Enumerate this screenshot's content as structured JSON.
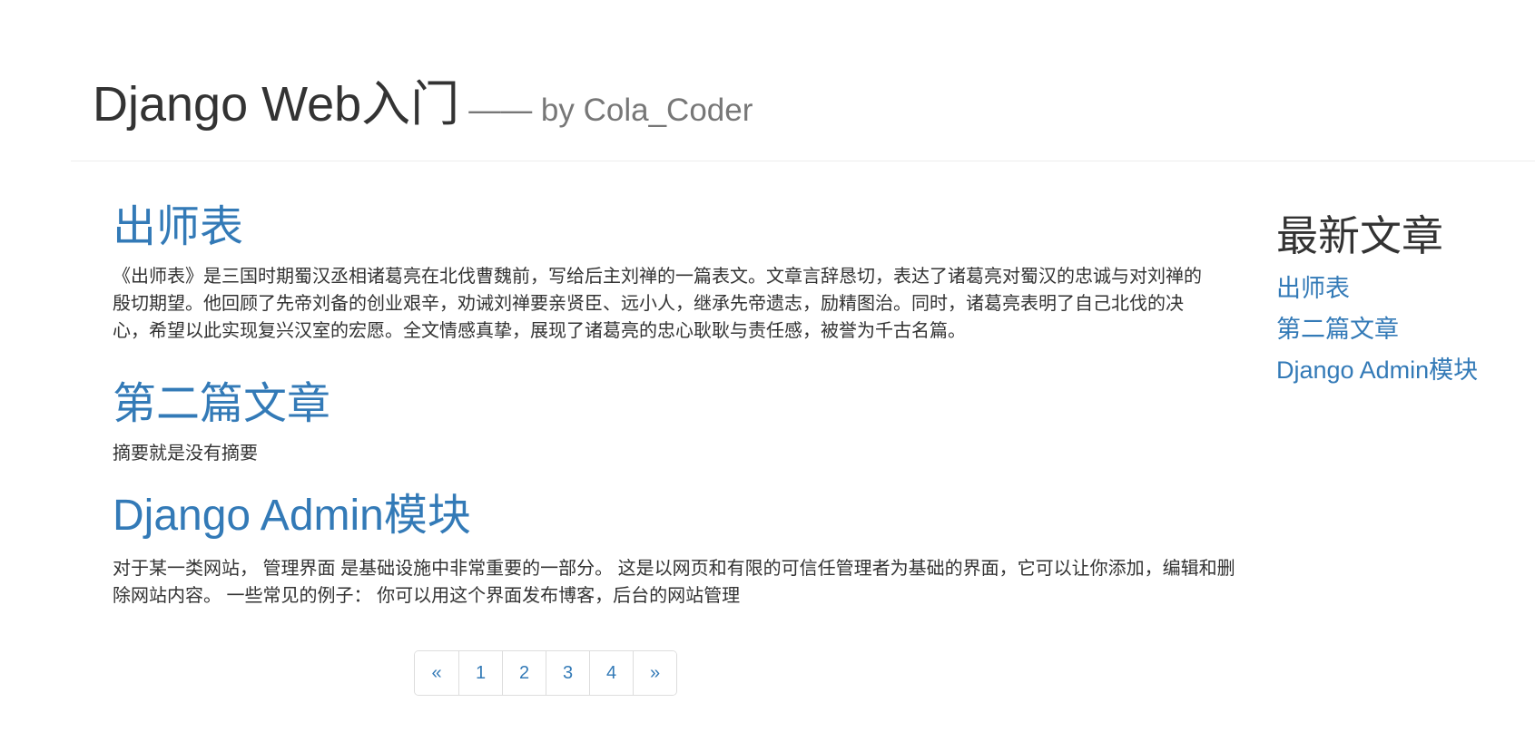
{
  "header": {
    "title": "Django Web入门",
    "subtitle": "—— by Cola_Coder"
  },
  "articles": [
    {
      "title": "出师表",
      "summary": "《出师表》是三国时期蜀汉丞相诸葛亮在北伐曹魏前，写给后主刘禅的一篇表文。文章言辞恳切，表达了诸葛亮对蜀汉的忠诚与对刘禅的殷切期望。他回顾了先帝刘备的创业艰辛，劝诫刘禅要亲贤臣、远小人，继承先帝遗志，励精图治。同时，诸葛亮表明了自己北伐的决心，希望以此实现复兴汉室的宏愿。全文情感真挚，展现了诸葛亮的忠心耿耿与责任感，被誉为千古名篇。"
    },
    {
      "title": "第二篇文章",
      "summary": "摘要就是没有摘要"
    },
    {
      "title": "Django Admin模块",
      "summary": "对于某一类网站， 管理界面 是基础设施中非常重要的一部分。 这是以网页和有限的可信任管理者为基础的界面，它可以让你添加，编辑和删除网站内容。 一些常见的例子： 你可以用这个界面发布博客，后台的网站管理"
    }
  ],
  "pagination": {
    "prev": "«",
    "pages": [
      "1",
      "2",
      "3",
      "4"
    ],
    "next": "»"
  },
  "sidebar": {
    "title": "最新文章",
    "items": [
      "出师表",
      "第二篇文章",
      "Django Admin模块"
    ]
  },
  "colors": {
    "link": "#337ab7",
    "text": "#333333",
    "muted": "#777777",
    "border": "#dddddd"
  }
}
